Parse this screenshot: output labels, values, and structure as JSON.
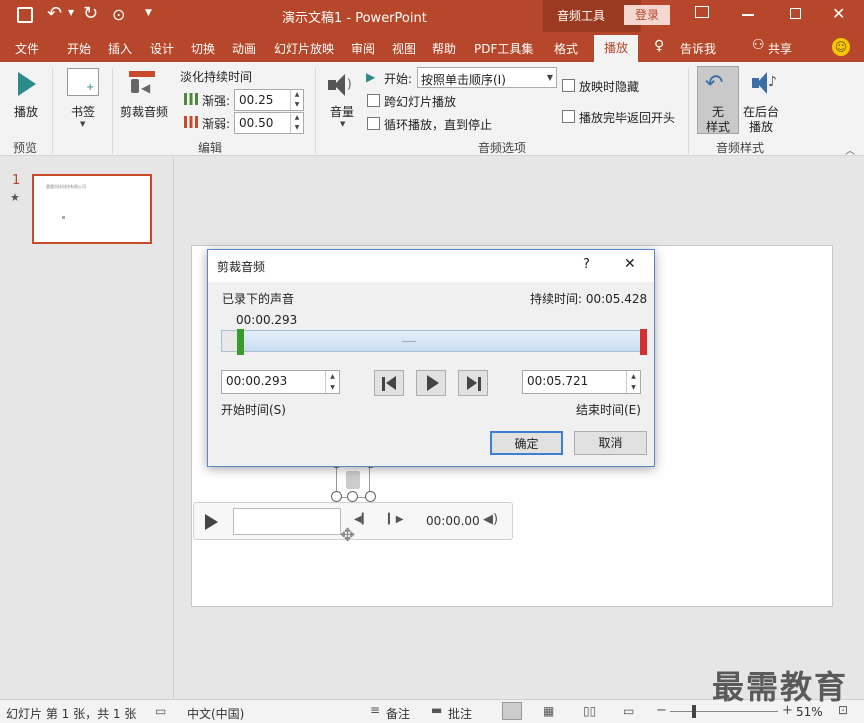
{
  "titlebar": {
    "doc_title": "演示文稿1 - PowerPoint",
    "context_tool": "音频工具",
    "login": "登录"
  },
  "tabs": [
    {
      "label": "文件"
    },
    {
      "label": "开始"
    },
    {
      "label": "插入"
    },
    {
      "label": "设计"
    },
    {
      "label": "切换"
    },
    {
      "label": "动画"
    },
    {
      "label": "幻灯片放映"
    },
    {
      "label": "审阅"
    },
    {
      "label": "视图"
    },
    {
      "label": "帮助"
    },
    {
      "label": "PDF工具集"
    },
    {
      "label": "格式"
    },
    {
      "label": "播放"
    },
    {
      "label": "告诉我"
    },
    {
      "label": "共享"
    }
  ],
  "ribbon": {
    "preview": {
      "btn": "播放",
      "group": "预览"
    },
    "bookmark": {
      "btn": "书签"
    },
    "edit": {
      "trim_btn": "剪裁音频",
      "fade_title": "淡化持续时间",
      "fade_in_label": "渐强:",
      "fade_in_value": "00.25",
      "fade_out_label": "渐弱:",
      "fade_out_value": "00.50",
      "group": "编辑"
    },
    "audio_options": {
      "volume": "音量",
      "start_label": "开始:",
      "start_value": "按照单击顺序(I)",
      "cross_slides": "跨幻灯片播放",
      "loop": "循环播放，直到停止",
      "hide": "放映时隐藏",
      "rewind": "播放完毕返回开头",
      "group": "音频选项"
    },
    "audio_styles": {
      "none_line1": "无",
      "none_line2": "样式",
      "bg_line1": "在后台",
      "bg_line2": "播放",
      "group": "音频样式"
    }
  },
  "thumbnail": {
    "number": "1",
    "star": "★",
    "text": "鹿鹿科技科技有限公司"
  },
  "dialog": {
    "title": "剪裁音频",
    "help": "?",
    "close": "✕",
    "recorded_label": "已录下的声音",
    "duration_label": "持续时间: 00:05.428",
    "marker_time": "00:00.293",
    "start_value": "00:00.293",
    "end_value": "00:05.721",
    "start_label": "开始时间(S)",
    "end_label": "结束时间(E)",
    "ok": "确定",
    "cancel": "取消"
  },
  "player": {
    "time": "00:00.00"
  },
  "status": {
    "slide_info": "幻灯片 第 1 张，共 1 张",
    "language": "中文(中国)",
    "notes": "备注",
    "comments": "批注",
    "zoom": "51%"
  },
  "watermark": "最需教育"
}
